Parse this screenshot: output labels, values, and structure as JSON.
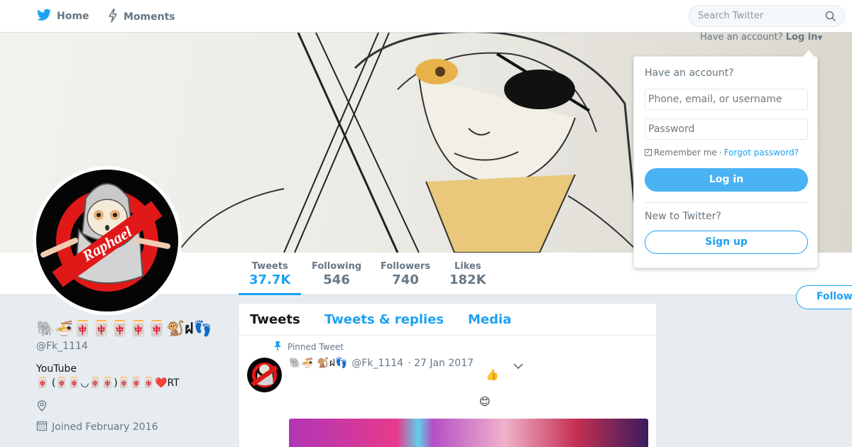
{
  "nav": {
    "home_label": "Home",
    "moments_label": "Moments",
    "search_placeholder": "Search Twitter"
  },
  "colors": {
    "accent": "#1da1f2",
    "background": "#e6ecf0"
  },
  "profile": {
    "name": "🐘🍜🀄🀄🀄🀄🀄🐒ฝ👣",
    "handle": "@Fk_1114",
    "bio_line1": "YouTube",
    "bio_line2": "🀄 (🀄🀄◡🀄🀄)🀄🀄🀄❤️RT",
    "joined": "Joined February 2016",
    "avatar_text": "Raphael",
    "follow_label": "Follow"
  },
  "stats": [
    {
      "label": "Tweets",
      "value": "37.7K"
    },
    {
      "label": "Following",
      "value": "546"
    },
    {
      "label": "Followers",
      "value": "740"
    },
    {
      "label": "Likes",
      "value": "182K"
    }
  ],
  "timeline": {
    "tabs": [
      "Tweets",
      "Tweets & replies",
      "Media"
    ],
    "pinned_label": "Pinned Tweet",
    "tweet": {
      "name": "🐘🍜   🐒ฝ👣",
      "handle": "@Fk_1114",
      "date": "· 27 Jan 2017",
      "emoji_line1": "👍",
      "emoji_line2": "😊"
    }
  },
  "login": {
    "trigger_prefix": "Have an account?",
    "trigger_link": "Log in",
    "title": "Have an account?",
    "username_placeholder": "Phone, email, or username",
    "password_placeholder": "Password",
    "remember_label": "Remember me",
    "separator": "·",
    "forgot_label": "Forgot password?",
    "login_button": "Log in",
    "new_label": "New to Twitter?",
    "signup_button": "Sign up"
  }
}
